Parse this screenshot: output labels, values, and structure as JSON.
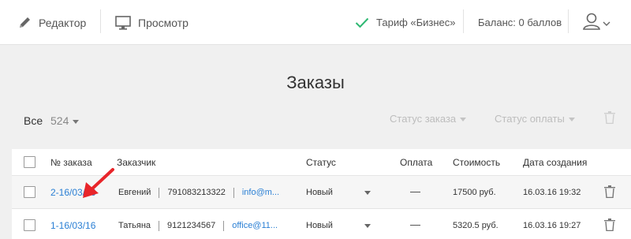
{
  "toolbar": {
    "editor_label": "Редактор",
    "preview_label": "Просмотр",
    "tariff_label": "Тариф «Бизнес»",
    "balance_label": "Баланс: 0 баллов"
  },
  "page": {
    "title": "Заказы"
  },
  "filters": {
    "all_label": "Все",
    "count": "524",
    "order_status_label": "Статус заказа",
    "payment_status_label": "Статус оплаты"
  },
  "table": {
    "columns": [
      "№ заказа",
      "Заказчик",
      "Статус",
      "Оплата",
      "Стоимость",
      "Дата создания"
    ],
    "rows": [
      {
        "order_no": "2-16/03/16",
        "name": "Евгений",
        "phone": "791083213322",
        "email": "info@m...",
        "status": "Новый",
        "price": "17500 руб.",
        "date": "16.03.16 19:32"
      },
      {
        "order_no": "1-16/03/16",
        "name": "Татьяна",
        "phone": "9121234567",
        "email": "office@11...",
        "status": "Новый",
        "price": "5320.5 руб.",
        "date": "16.03.16 19:27"
      }
    ]
  },
  "colors": {
    "accent_link": "#2a7fd4",
    "check_green": "#2eb872",
    "arrow_red": "#e8252a"
  }
}
